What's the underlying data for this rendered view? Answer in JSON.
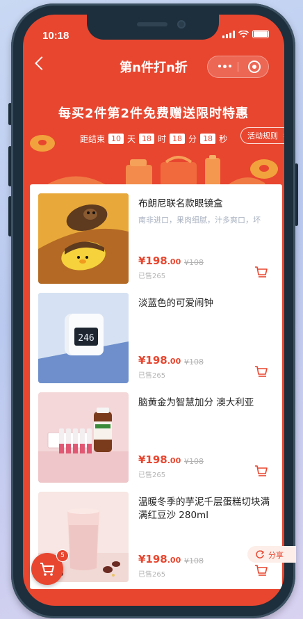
{
  "status_bar": {
    "time": "10:18"
  },
  "nav": {
    "title": "第n件打n折"
  },
  "hero": {
    "title": "每买2件第2件免费赠送限时特惠",
    "countdown": {
      "prefix": "距结束",
      "days": "10",
      "days_unit": "天",
      "hours": "18",
      "hours_unit": "时",
      "minutes": "18",
      "minutes_unit": "分",
      "seconds": "18",
      "seconds_unit": "秒"
    },
    "rules_label": "活动规则",
    "rules_chevron": "›"
  },
  "products": [
    {
      "title": "布朗尼联名款眼镜盒",
      "subtitle": "南非进口，果肉细腻，汁多爽口，坏",
      "price_main": "¥198",
      "price_cents": ".00",
      "old_price": "¥108",
      "sold": "已售265"
    },
    {
      "title": "淡蓝色的可爱闹钟",
      "subtitle": "",
      "price_main": "¥198",
      "price_cents": ".00",
      "old_price": "¥108",
      "sold": "已售265",
      "clock_display": "246"
    },
    {
      "title": "脑黄金为智慧加分 澳大利亚",
      "subtitle": "",
      "price_main": "¥198",
      "price_cents": ".00",
      "old_price": "¥108",
      "sold": "已售265"
    },
    {
      "title": "温暖冬季的芋泥千层蛋糕切块满满红豆沙 280ml",
      "subtitle": "",
      "price_main": "¥198",
      "price_cents": ".00",
      "old_price": "¥108",
      "sold": "已售265"
    }
  ],
  "floating": {
    "cart_badge": "5",
    "share_label": "分享"
  },
  "colors": {
    "accent": "#e8462f",
    "accent_light": "#fdeee9",
    "muted": "#b3b3b3"
  }
}
